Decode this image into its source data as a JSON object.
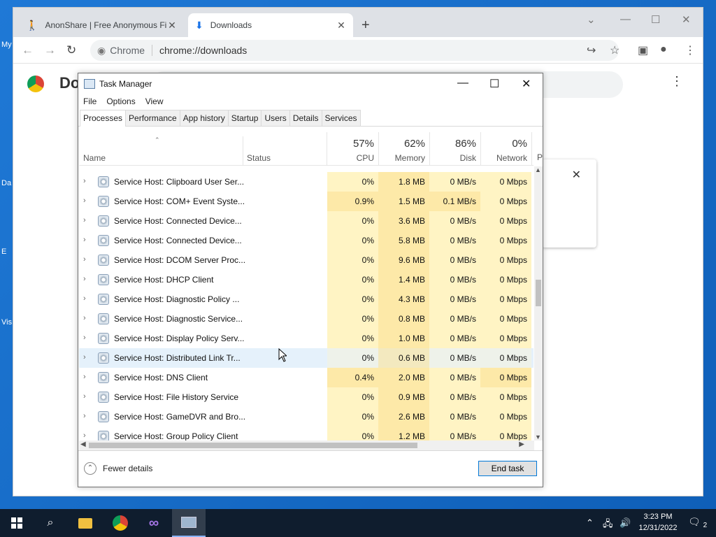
{
  "desktop": {
    "labels": [
      "My",
      "Da",
      "E",
      "Vis"
    ]
  },
  "chrome": {
    "tabs": [
      {
        "title": "AnonShare | Free Anonymous Fi",
        "active": false
      },
      {
        "title": "Downloads",
        "active": true
      }
    ],
    "omnibox": {
      "chip": "Chrome",
      "url": "chrome://downloads"
    },
    "page": {
      "title": "Do"
    }
  },
  "task_manager": {
    "title": "Task Manager",
    "menu": [
      "File",
      "Options",
      "View"
    ],
    "tabs": [
      "Processes",
      "Performance",
      "App history",
      "Startup",
      "Users",
      "Details",
      "Services"
    ],
    "active_tab": "Processes",
    "columns": {
      "name": "Name",
      "status": "Status",
      "cpu": {
        "label": "CPU",
        "pct": "57%"
      },
      "memory": {
        "label": "Memory",
        "pct": "62%"
      },
      "disk": {
        "label": "Disk",
        "pct": "86%"
      },
      "network": {
        "label": "Network",
        "pct": "0%"
      },
      "partial": "P"
    },
    "rows": [
      {
        "name": "Service Host: Clipboard User Ser...",
        "cpu": "0%",
        "memory": "1.8 MB",
        "disk": "0 MB/s",
        "network": "0 Mbps"
      },
      {
        "name": "Service Host: COM+ Event Syste...",
        "cpu": "0.9%",
        "memory": "1.5 MB",
        "disk": "0.1 MB/s",
        "network": "0 Mbps"
      },
      {
        "name": "Service Host: Connected Device...",
        "cpu": "0%",
        "memory": "3.6 MB",
        "disk": "0 MB/s",
        "network": "0 Mbps"
      },
      {
        "name": "Service Host: Connected Device...",
        "cpu": "0%",
        "memory": "5.8 MB",
        "disk": "0 MB/s",
        "network": "0 Mbps"
      },
      {
        "name": "Service Host: DCOM Server Proc...",
        "cpu": "0%",
        "memory": "9.6 MB",
        "disk": "0 MB/s",
        "network": "0 Mbps"
      },
      {
        "name": "Service Host: DHCP Client",
        "cpu": "0%",
        "memory": "1.4 MB",
        "disk": "0 MB/s",
        "network": "0 Mbps"
      },
      {
        "name": "Service Host: Diagnostic Policy ...",
        "cpu": "0%",
        "memory": "4.3 MB",
        "disk": "0 MB/s",
        "network": "0 Mbps"
      },
      {
        "name": "Service Host: Diagnostic Service...",
        "cpu": "0%",
        "memory": "0.8 MB",
        "disk": "0 MB/s",
        "network": "0 Mbps"
      },
      {
        "name": "Service Host: Display Policy Serv...",
        "cpu": "0%",
        "memory": "1.0 MB",
        "disk": "0 MB/s",
        "network": "0 Mbps"
      },
      {
        "name": "Service Host: Distributed Link Tr...",
        "cpu": "0%",
        "memory": "0.6 MB",
        "disk": "0 MB/s",
        "network": "0 Mbps"
      },
      {
        "name": "Service Host: DNS Client",
        "cpu": "0.4%",
        "memory": "2.0 MB",
        "disk": "0 MB/s",
        "network": "0 Mbps"
      },
      {
        "name": "Service Host: File History Service",
        "cpu": "0%",
        "memory": "0.9 MB",
        "disk": "0 MB/s",
        "network": "0 Mbps"
      },
      {
        "name": "Service Host: GameDVR and Bro...",
        "cpu": "0%",
        "memory": "2.6 MB",
        "disk": "0 MB/s",
        "network": "0 Mbps"
      },
      {
        "name": "Service Host: Group Policy Client",
        "cpu": "0%",
        "memory": "1.2 MB",
        "disk": "0 MB/s",
        "network": "0 Mbps"
      }
    ],
    "highlighted_row": 9,
    "footer": {
      "fewer_details": "Fewer details",
      "end_task": "End task"
    }
  },
  "taskbar": {
    "clock": {
      "time": "3:23 PM",
      "date": "12/31/2022"
    },
    "notifications": "2"
  }
}
